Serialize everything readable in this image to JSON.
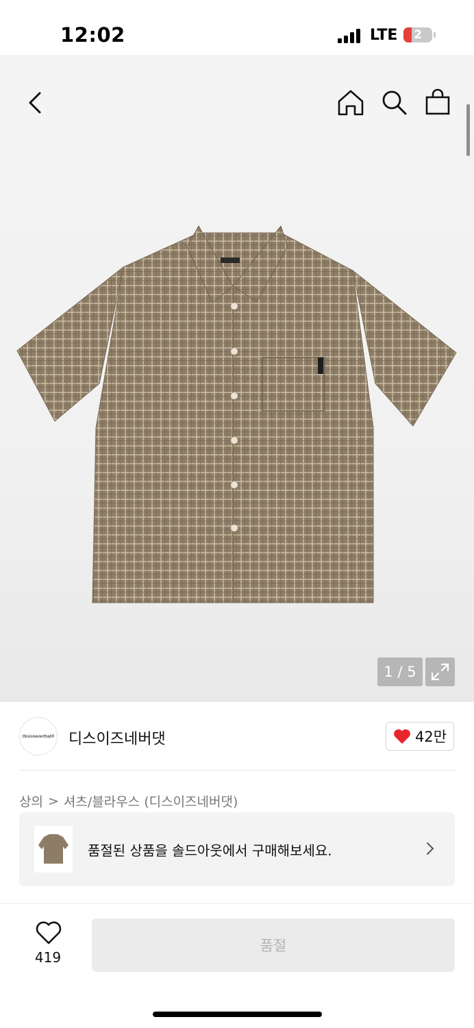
{
  "status_bar": {
    "time": "12:02",
    "network": "LTE",
    "battery": "2"
  },
  "nav": {
    "icons": [
      "back-icon",
      "home-icon",
      "search-icon",
      "bag-icon"
    ]
  },
  "gallery": {
    "counter": "1 / 5",
    "expand_icon": "expand-icon"
  },
  "brand": {
    "logo_text": "thisisneverthat®",
    "name": "디스이즈네버댓",
    "like_count": "42만"
  },
  "breadcrumb": {
    "category": "상의",
    "separator": ">",
    "subcategory": "셔츠/블라우스 (디스이즈네버댓)"
  },
  "soldout_banner": {
    "text": "품절된 상품을 솔드아웃에서 구매해보세요."
  },
  "bottom": {
    "wish_count": "419",
    "buy_label": "품절"
  },
  "colors": {
    "like_red": "#e8242c",
    "shirt_base": "#8e7d66",
    "disabled_bg": "#ebebeb"
  }
}
